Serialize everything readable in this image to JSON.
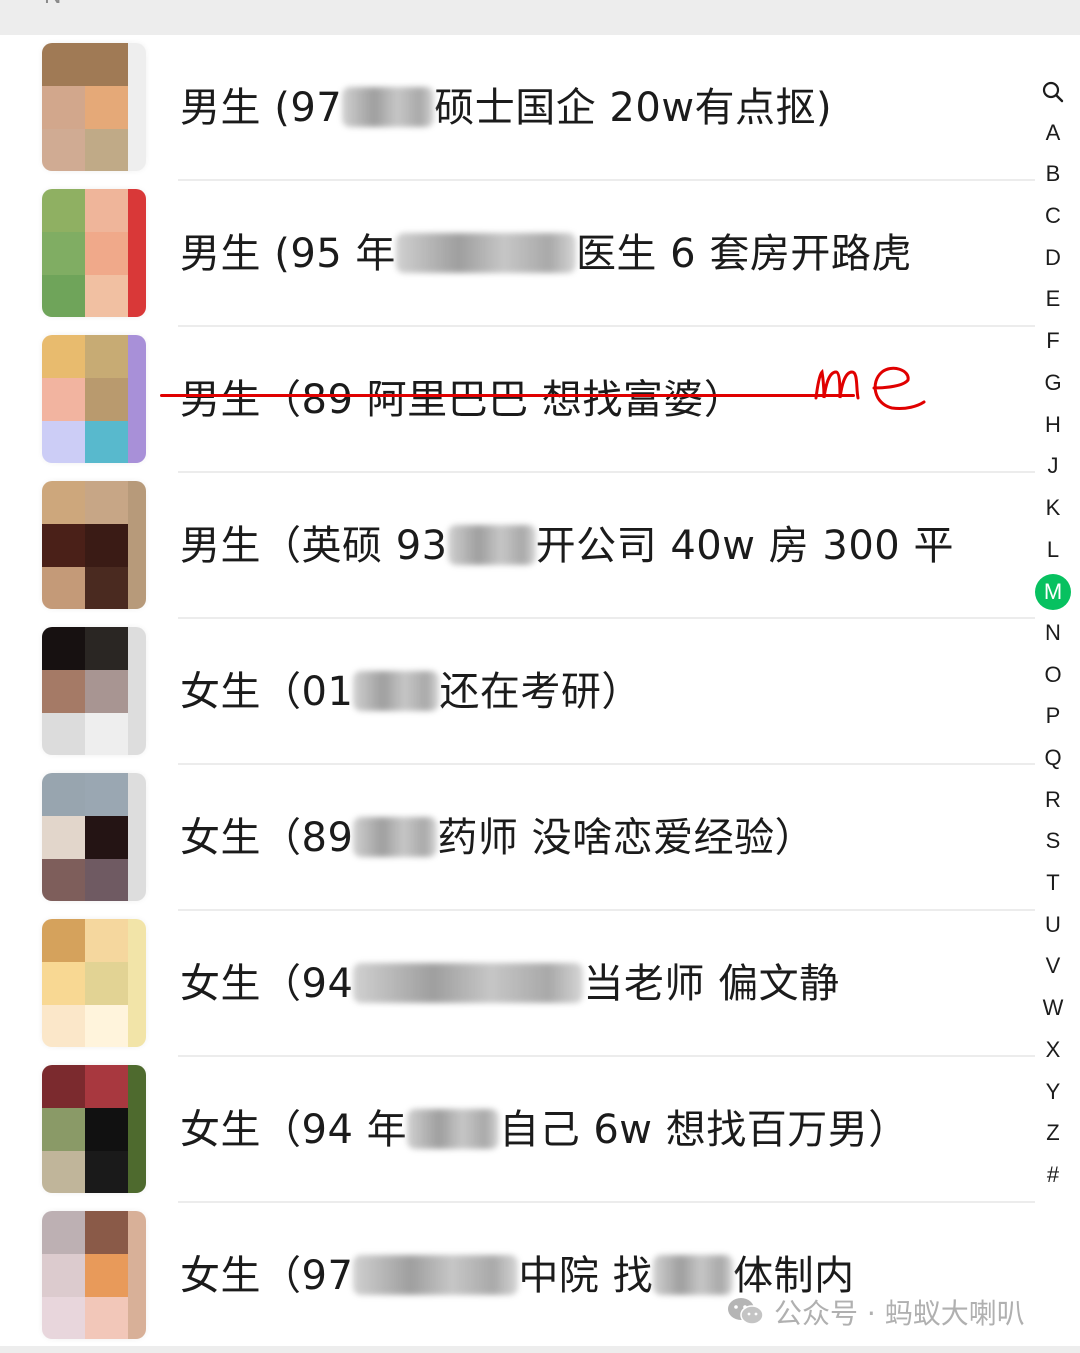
{
  "section_letter": "N",
  "contacts": [
    {
      "prefix": "男生 (97",
      "blur_width": 92,
      "suffix": "硕士国企 20w有点抠)",
      "avatar_colors": [
        "#a07a55",
        "#a07a55",
        "#d2a78c",
        "#e5a978",
        "#d0ab93",
        "#c0aa87"
      ],
      "avatar_edge": "#eeeeee"
    },
    {
      "prefix": "男生 (95 年",
      "blur_width": 180,
      "suffix": "医生 6 套房开路虎",
      "avatar_colors": [
        "#8fb062",
        "#efb59a",
        "#80ad63",
        "#f0a98a",
        "#6fa45a",
        "#f1c0a2"
      ],
      "avatar_edge": "#d93838"
    },
    {
      "prefix": "男生（89 阿里巴巴 想找富婆）",
      "blur_width": 0,
      "suffix": "",
      "avatar_colors": [
        "#e8bb6e",
        "#c7ab74",
        "#f2b4a0",
        "#b99a6e",
        "#cccdf6",
        "#58b9cd"
      ],
      "avatar_edge": "#a890d8"
    },
    {
      "prefix": "男生（英硕 93",
      "blur_width": 88,
      "suffix": "开公司 40w 房 300 平",
      "avatar_colors": [
        "#cda77c",
        "#c7a686",
        "#4a2018",
        "#3a1b15",
        "#c49a78",
        "#4a2a20"
      ],
      "avatar_edge": "#b79a7a"
    },
    {
      "prefix": "女生（01",
      "blur_width": 86,
      "suffix": "还在考研）",
      "avatar_colors": [
        "#171111",
        "#2a2623",
        "#a57a66",
        "#a89592",
        "#dcdcdc",
        "#eeeeee"
      ],
      "avatar_edge": "#dddddd"
    },
    {
      "prefix": "女生（89",
      "blur_width": 84,
      "suffix": "药师 没啥恋爱经验）",
      "avatar_colors": [
        "#98a5af",
        "#9aa7b2",
        "#e2d6cb",
        "#241414",
        "#7e5e5b",
        "#6f5a62"
      ],
      "avatar_edge": "#dddddd"
    },
    {
      "prefix": "女生（94",
      "blur_width": 230,
      "suffix": "当老师 偏文静",
      "avatar_colors": [
        "#d5a25c",
        "#f5d79e",
        "#f8d893",
        "#e2d394",
        "#fbe7c9",
        "#fff4dc"
      ],
      "avatar_edge": "#f2e4a8"
    },
    {
      "prefix": "女生（94 年",
      "blur_width": 92,
      "suffix": "自己 6w 想找百万男）",
      "avatar_colors": [
        "#7b2a2e",
        "#a8383f",
        "#8a9a67",
        "#111111",
        "#c0b59a",
        "#1a1a1a"
      ],
      "avatar_edge": "#4e6a2e"
    },
    {
      "prefix": "女生（97",
      "blur_width": 165,
      "suffix": "中院 找",
      "blur2_width": 80,
      "suffix2": "体制内",
      "avatar_colors": [
        "#bdb0b3",
        "#8a5a48",
        "#dccbce",
        "#e89a5a",
        "#e8d6dc",
        "#f2c7b9"
      ],
      "avatar_edge": "#d8b098"
    }
  ],
  "annotation": {
    "text": "me",
    "color": "#e00000"
  },
  "index": [
    "search",
    "A",
    "B",
    "C",
    "D",
    "E",
    "F",
    "G",
    "H",
    "J",
    "K",
    "L",
    "M",
    "N",
    "O",
    "P",
    "Q",
    "R",
    "S",
    "T",
    "U",
    "V",
    "W",
    "X",
    "Y",
    "Z",
    "#"
  ],
  "index_active": "M",
  "active_color": "#07c160",
  "watermark": {
    "label": "公众号 · 蚂蚁大喇叭"
  }
}
